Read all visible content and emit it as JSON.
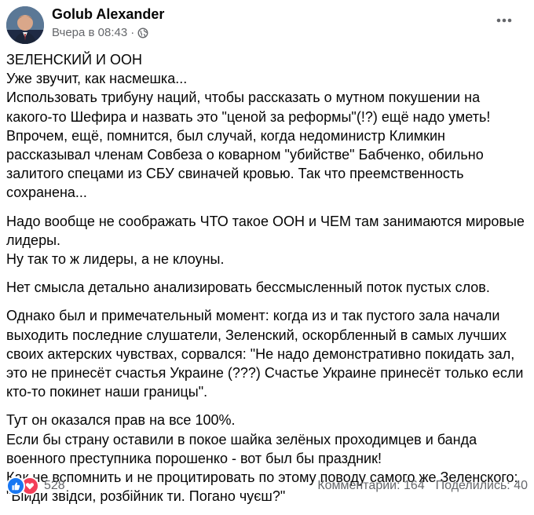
{
  "post": {
    "author": "Golub Alexander",
    "timestamp": "Вчера в 08:43",
    "separator": "·",
    "audience_icon": "globe-icon",
    "more_icon": "more-icon",
    "paragraphs": [
      "ЗЕЛЕНСКИЙ И ООН\nУже звучит, как насмешка...\nИспользовать трибуну наций, чтобы рассказать о мутном покушении на какого-то  Шефира и назвать это \"ценой за реформы\"(!?) ещё надо уметь! Впрочем, ещё, помнится, был  случай, когда недоминистр Климкин рассказывал членам Совбеза о коварном \"убийстве\" Бабченко, обильно залитого спецами из СБУ свиначей кровью. Так что преемственность сохранена...",
      "Надо вообще не соображать ЧТО такое ООН и ЧЕМ там занимаются мировые лидеры.\nНу так то ж лидеры, а не клоуны.",
      "Нет смысла детально анализировать бессмысленный поток пустых слов.",
      "Однако был и примечательный момент: когда из и так пустого зала начали выходить последние слушатели, Зеленский, оскорбленный в самых лучших своих актерских чувствах, сорвался: \"Не надо демонстративно покидать зал, это не принесёт счастья Украине (???) Счастье Украине принесёт только если кто-то покинет наши границы\".",
      "Тут он оказался прав на все 100%.\nЕсли бы страну оставили в покое шайка зелёных проходимцев и банда военного преступника порошенко - вот был бы праздник!\nКак не вспомнить и не процитировать по этому поводу самого же Зеленского:\n\"Вiйди звiдси, розбiйник ти. Погано чуєш?\""
    ],
    "reactions": {
      "icons": [
        "like-icon",
        "love-icon"
      ],
      "count": "528"
    },
    "comments": "Комментарии: 164",
    "shares": "Поделились: 40"
  },
  "colors": {
    "like": "#1877f2",
    "love": "#f33e58",
    "secondary_text": "#65676b"
  }
}
